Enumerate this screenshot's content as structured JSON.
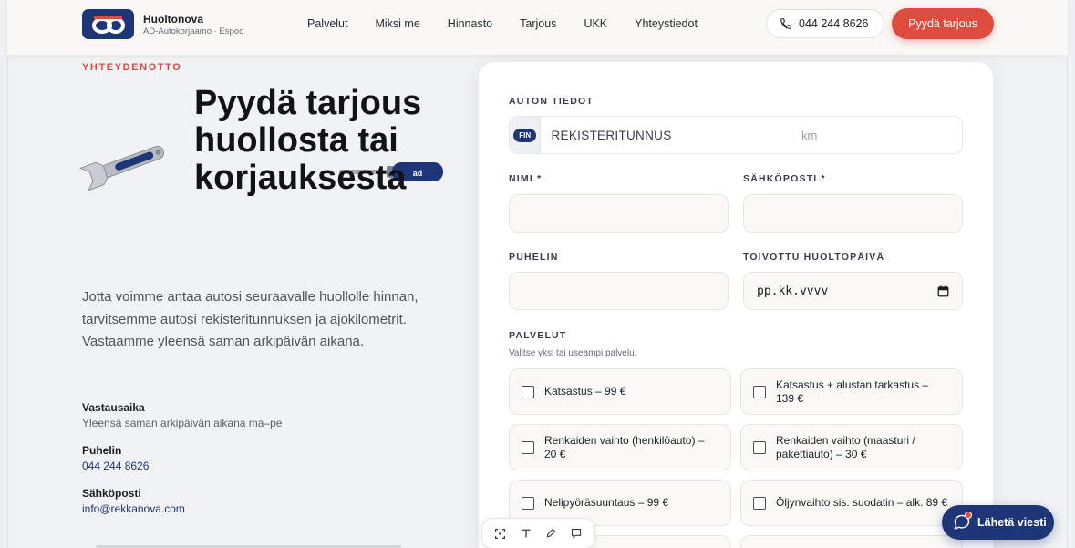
{
  "header": {
    "brand_name": "Huoltonova",
    "brand_sub": "AD-Autokorjaamo · Espoo",
    "nav": [
      "Palvelut",
      "Miksi me",
      "Hinnasto",
      "Tarjous",
      "UKK",
      "Yhteystiedot"
    ],
    "phone": "044 244 8626",
    "cta": "Pyydä tarjous"
  },
  "intro": {
    "eyebrow": "YHTEYDENOTTO",
    "headline": "Pyydä tarjous huollosta tai korjauksesta",
    "body": "Jotta voimme antaa autosi seuraavalle huollolle hinnan, tarvitsemme autosi rekisteritunnuksen ja ajokilometrit. Vastaamme yleensä saman arkipäivän aikana.",
    "response_label": "Vastausaika",
    "response_value": "Yleensä saman arkipäivän aikana ma–pe",
    "phone_label": "Puhelin",
    "phone_value": "044 244 8626",
    "email_label": "Sähköposti",
    "email_value": "info@rekkanova.com"
  },
  "form": {
    "car_section": "AUTON TIEDOT",
    "fin_badge": "FIN",
    "reg_placeholder": "REKISTERITUNNUS",
    "km_placeholder": "km",
    "name_label": "NIMI *",
    "email_label": "SÄHKÖPOSTI *",
    "phone_label": "PUHELIN",
    "date_label": "TOIVOTTU HUOLTOPÄIVÄ",
    "date_placeholder": "pp.kk.vvvv",
    "services_label": "PALVELUT",
    "services_help": "Valitse yksi tai useampi palvelu.",
    "services": [
      "Katsastus – 99 €",
      "Katsastus + alustan tarkastus – 139 €",
      "Renkaiden vaihto (henkilöauto) – 20 €",
      "Renkaiden vaihto (maasturi / pakettiauto) – 30 €",
      "Nelipyöräsuuntaus – 99 €",
      "Öljynvaihto sis. suodatin – alk. 89 €"
    ]
  },
  "chat": {
    "label": "Lähetä viesti"
  },
  "icons": {
    "phone": "phone-icon",
    "chat": "chat-bubble-icon",
    "calendar": "calendar-icon"
  },
  "colors": {
    "brand_blue": "#1e3578",
    "accent_red": "#e04b3f"
  }
}
